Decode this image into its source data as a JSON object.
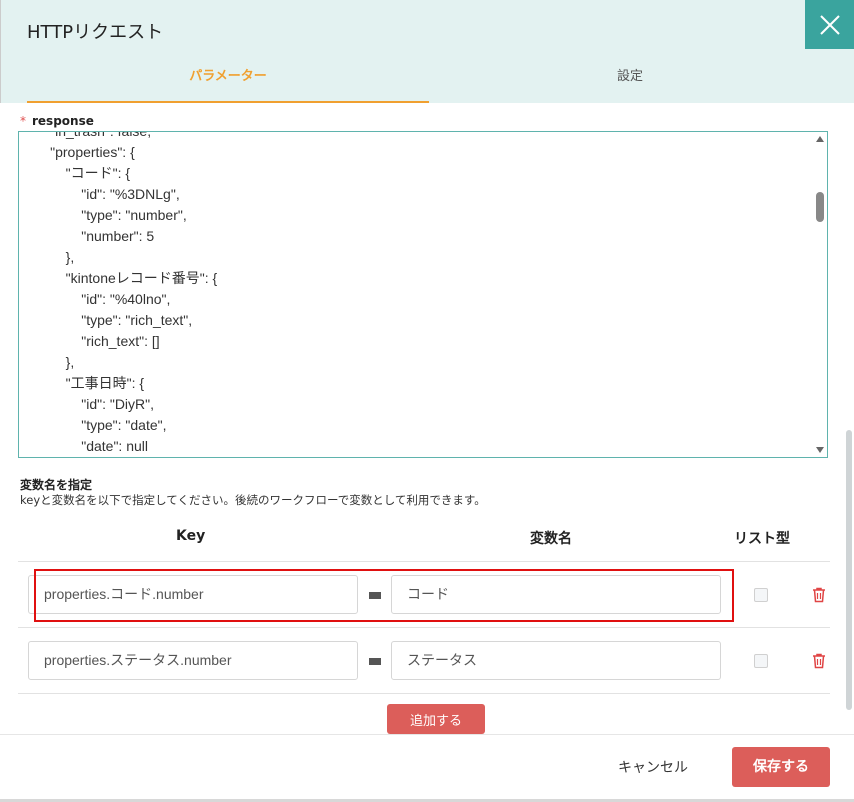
{
  "dialog": {
    "title": "HTTPリクエスト",
    "close_icon": "close-icon"
  },
  "tabs": [
    {
      "label": "パラメーター",
      "active": true
    },
    {
      "label": "設定",
      "active": false
    }
  ],
  "response": {
    "required_mark": "*",
    "label": "response",
    "code_lines": [
      "        \"in_trash\": false,",
      "        \"properties\": {",
      "            \"コード\": {",
      "                \"id\": \"%3DNLg\",",
      "                \"type\": \"number\",",
      "                \"number\": 5",
      "            },",
      "            \"kintoneレコード番号\": {",
      "                \"id\": \"%40lno\",",
      "                \"type\": \"rich_text\",",
      "                \"rich_text\": []",
      "            },",
      "            \"工事日時\": {",
      "                \"id\": \"DiyR\",",
      "                \"type\": \"date\",",
      "                \"date\": null"
    ]
  },
  "variables": {
    "title": "変数名を指定",
    "description": "keyと変数名を以下で指定してください。後続のワークフローで変数として利用できます。",
    "headers": {
      "key": "Key",
      "var": "変数名",
      "list": "リスト型"
    },
    "rows": [
      {
        "key": "properties.コード.number",
        "var": "コード",
        "list": false
      },
      {
        "key": "properties.ステータス.number",
        "var": "ステータス",
        "list": false
      }
    ],
    "add_label": "追加する"
  },
  "footer": {
    "cancel_label": "キャンセル",
    "save_label": "保存する"
  },
  "colors": {
    "header_bg": "#e3f2f1",
    "close_bg": "#3aa49e",
    "tab_active": "#f0a030",
    "primary_button": "#dc5e5a",
    "highlight": "#e01010"
  }
}
